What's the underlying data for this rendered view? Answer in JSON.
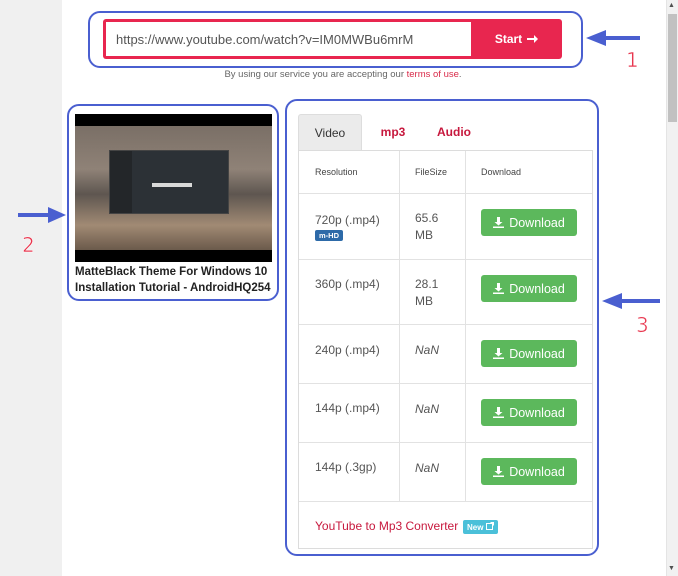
{
  "search": {
    "url_value": "https://www.youtube.com/watch?v=IM0MWBu6mrM",
    "start_label": "Start",
    "terms_prefix": "By using our service you are accepting our",
    "terms_link": "terms of use",
    "terms_suffix": "."
  },
  "video": {
    "title_line1": "MatteBlack Theme For Windows 10",
    "title_line2": "Installation Tutorial - AndroidHQ254"
  },
  "tabs": [
    {
      "label": "Video",
      "active": true
    },
    {
      "label": "mp3",
      "active": false
    },
    {
      "label": "Audio",
      "active": false
    }
  ],
  "table": {
    "headers": {
      "resolution": "Resolution",
      "filesize": "FileSize",
      "download": "Download"
    },
    "rows": [
      {
        "resolution": "720p (.mp4)",
        "badge": "m-HD",
        "size_line1": "65.6",
        "size_line2": "MB",
        "button": "Download"
      },
      {
        "resolution": "360p (.mp4)",
        "size_line1": "28.1",
        "size_line2": "MB",
        "button": "Download"
      },
      {
        "resolution": "240p (.mp4)",
        "size_line1": "NaN",
        "button": "Download"
      },
      {
        "resolution": "144p (.mp4)",
        "size_line1": "NaN",
        "button": "Download"
      },
      {
        "resolution": "144p (.3gp)",
        "size_line1": "NaN",
        "button": "Download"
      }
    ],
    "converter_link": "YouTube to Mp3 Converter",
    "new_badge": "New"
  },
  "callouts": [
    "1",
    "2",
    "3"
  ],
  "colors": {
    "brand_red": "#e8264f",
    "download_green": "#5cb85c",
    "callout_blue": "#4a5fd0",
    "number_red": "#e8364e"
  },
  "icons": {
    "start": "arrow-right-icon",
    "download": "download-icon",
    "new": "external-link-icon"
  }
}
